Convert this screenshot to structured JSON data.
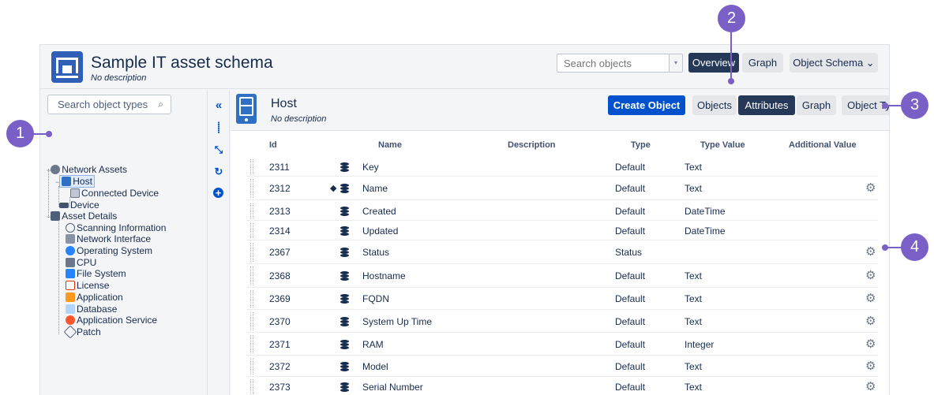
{
  "header": {
    "schema_title": "Sample IT asset schema",
    "schema_description": "No description",
    "search_placeholder": "Search objects",
    "search_dropdown_icon": "▾",
    "overview_label": "Overview",
    "graph_label": "Graph",
    "object_schema_label": "Object Schema ⌄"
  },
  "sidebar": {
    "search_placeholder": "Search object types",
    "search_icon": "⌕",
    "items": [
      {
        "label": "Network Assets",
        "icon": "network-icon"
      },
      {
        "label": "Host",
        "icon": "server-icon"
      },
      {
        "label": "Connected Device",
        "icon": "device-icon"
      },
      {
        "label": "Device",
        "icon": "router-icon"
      },
      {
        "label": "Asset Details",
        "icon": "details-icon"
      },
      {
        "label": "Scanning Information",
        "icon": "scan-icon"
      },
      {
        "label": "Network Interface",
        "icon": "interface-icon"
      },
      {
        "label": "Operating System",
        "icon": "os-icon"
      },
      {
        "label": "CPU",
        "icon": "cpu-icon"
      },
      {
        "label": "File System",
        "icon": "folder-icon"
      },
      {
        "label": "License",
        "icon": "license-icon"
      },
      {
        "label": "Application",
        "icon": "application-icon"
      },
      {
        "label": "Database",
        "icon": "database-icon"
      },
      {
        "label": "Application Service",
        "icon": "service-icon"
      },
      {
        "label": "Patch",
        "icon": "patch-icon"
      }
    ]
  },
  "tools": {
    "collapse": "«",
    "hierarchy": "⸽",
    "compress": "⤡",
    "refresh": "↻",
    "add": "+"
  },
  "object_type": {
    "title": "Host",
    "description": "No description",
    "create_label": "Create Object",
    "objects_label": "Objects",
    "attributes_label": "Attributes",
    "graph_label": "Graph",
    "object_type_label": "Object Type ⌄"
  },
  "table": {
    "columns": [
      "Id",
      "Name",
      "Description",
      "Type",
      "Type Value",
      "Additional Value"
    ],
    "rows": [
      {
        "id": "2311",
        "name": "Key",
        "type": "Default",
        "type_value": "Text",
        "gear": false,
        "label_icon": false
      },
      {
        "id": "2312",
        "name": "Name",
        "type": "Default",
        "type_value": "Text",
        "gear": true,
        "label_icon": true
      },
      {
        "id": "2313",
        "name": "Created",
        "type": "Default",
        "type_value": "DateTime",
        "gear": false,
        "label_icon": false
      },
      {
        "id": "2314",
        "name": "Updated",
        "type": "Default",
        "type_value": "DateTime",
        "gear": false,
        "label_icon": false
      },
      {
        "id": "2367",
        "name": "Status",
        "type": "Status",
        "type_value": "",
        "gear": true,
        "label_icon": false
      },
      {
        "id": "2368",
        "name": "Hostname",
        "type": "Default",
        "type_value": "Text",
        "gear": true,
        "label_icon": false
      },
      {
        "id": "2369",
        "name": "FQDN",
        "type": "Default",
        "type_value": "Text",
        "gear": true,
        "label_icon": false
      },
      {
        "id": "2370",
        "name": "System Up Time",
        "type": "Default",
        "type_value": "Text",
        "gear": true,
        "label_icon": false
      },
      {
        "id": "2371",
        "name": "RAM",
        "type": "Default",
        "type_value": "Integer",
        "gear": true,
        "label_icon": false
      },
      {
        "id": "2372",
        "name": "Model",
        "type": "Default",
        "type_value": "Text",
        "gear": true,
        "label_icon": false
      },
      {
        "id": "2373",
        "name": "Serial Number",
        "type": "Default",
        "type_value": "Text",
        "gear": true,
        "label_icon": false
      }
    ]
  },
  "callouts": [
    "1",
    "2",
    "3",
    "4"
  ],
  "colors": {
    "accent": "#7a5fc7",
    "primary": "#0052cc",
    "dark": "#253858"
  }
}
